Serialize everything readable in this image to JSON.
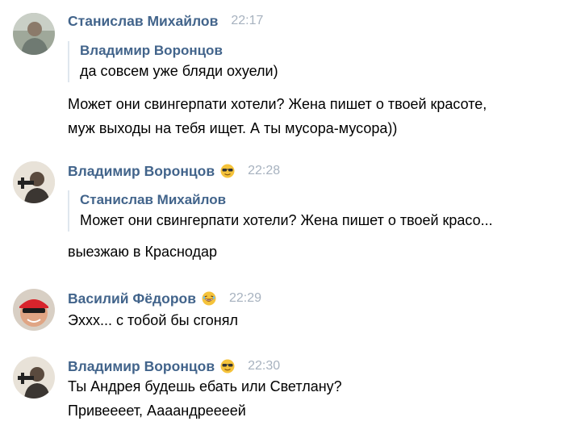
{
  "messages": [
    {
      "author": "Станислав Михайлов",
      "time": "22:17",
      "avatar": "avatar-stanislav",
      "emoji": null,
      "quote": {
        "author": "Владимир Воронцов",
        "text": "да совсем уже бляди охуели)"
      },
      "lines": [
        "Может они свингерпати хотели? Жена пишет о твоей красоте,",
        "муж выходы на тебя ищет. А ты мусора-мусора))"
      ]
    },
    {
      "author": "Владимир Воронцов",
      "time": "22:28",
      "avatar": "avatar-vladimir",
      "emoji": "sunglasses-emoji",
      "quote": {
        "author": "Станислав Михайлов",
        "text": "Может они свингерпати хотели? Жена пишет о твоей красо..."
      },
      "lines": [
        "выезжаю в Краснодар"
      ]
    },
    {
      "author": "Василий Фёдоров",
      "time": "22:29",
      "avatar": "avatar-vasily",
      "emoji": "laughing-emoji",
      "quote": null,
      "lines": [
        "Эххх... с тобой бы сгонял"
      ]
    },
    {
      "author": "Владимир Воронцов",
      "time": "22:30",
      "avatar": "avatar-vladimir",
      "emoji": "sunglasses-emoji",
      "quote": null,
      "lines": [
        "Ты Андрея будешь ебать или Светлану?",
        "Привеееет, Аааандрееeей"
      ]
    }
  ],
  "colors": {
    "author": "#42648b",
    "time": "#a7b2bf",
    "quote_border": "#dfe6ee",
    "text": "#000000",
    "background": "#ffffff"
  }
}
